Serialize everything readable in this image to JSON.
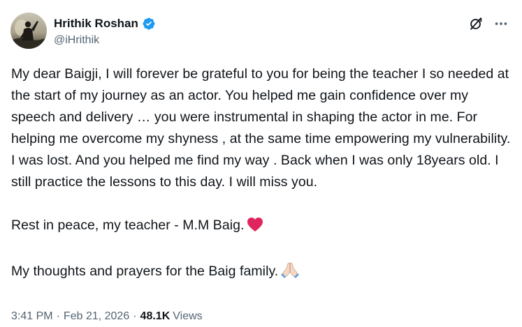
{
  "author": {
    "display_name": "Hrithik Roshan",
    "handle": "@iHrithik",
    "verified_icon": "verified-badge-icon",
    "verified_color": "#1d9bf0"
  },
  "header_actions": {
    "grok_icon": "grok-icon",
    "more_icon": "more-options-icon"
  },
  "tweet": {
    "paragraph_1": "My dear Baigji, I will forever be grateful to you for being the teacher I so needed at the start of my journey as an actor. You helped me gain confidence over my speech and delivery … you were instrumental in shaping the actor in me. For helping me overcome my shyness , at the same time empowering my vulnerability. I was lost. And you helped me find my way . Back when I was only 18years old. I still practice the lessons to this day. I will miss you.",
    "paragraph_2": "Rest in peace, my teacher - M.M Baig.",
    "paragraph_2_emoji": "red-heart-icon",
    "paragraph_3": "My thoughts and prayers for the Baig family.",
    "paragraph_3_emoji": "folded-hands-icon"
  },
  "meta": {
    "time": "3:41 PM",
    "separator": "·",
    "date": "Feb 21, 2026",
    "views_count": "48.1K",
    "views_label": "Views"
  },
  "colors": {
    "text_primary": "#0f1419",
    "text_secondary": "#536471",
    "heart": "#e0245e"
  }
}
